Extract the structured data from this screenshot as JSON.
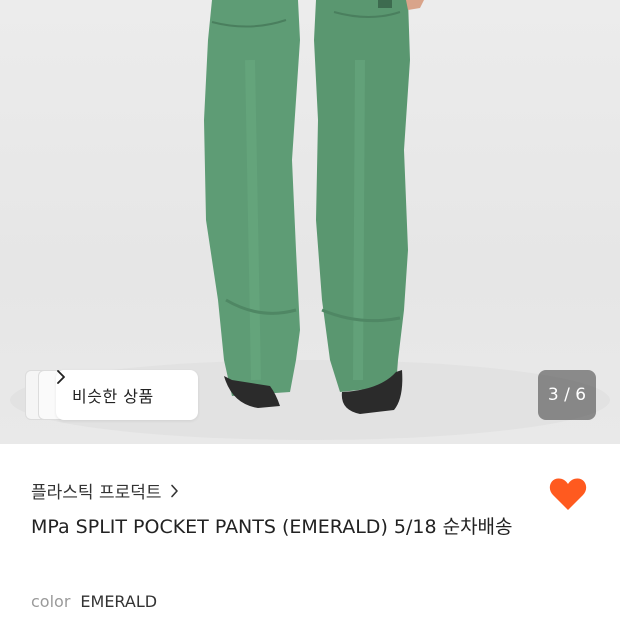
{
  "gallery": {
    "similar_products_label": "비슷한 상품",
    "counter_text": "3 / 6"
  },
  "product": {
    "brand": "플라스틱 프로덕트",
    "title": "MPa SPLIT POCKET PANTS (EMERALD) 5/18 순차배송",
    "option_label": "color",
    "option_value": "EMERALD"
  },
  "colors": {
    "like_heart": "#ff5a1f",
    "pants": "#5a9a72"
  },
  "icons": {
    "similar_chevron": "chevron-right-icon",
    "brand_chevron": "chevron-right-icon",
    "like": "heart-icon"
  }
}
